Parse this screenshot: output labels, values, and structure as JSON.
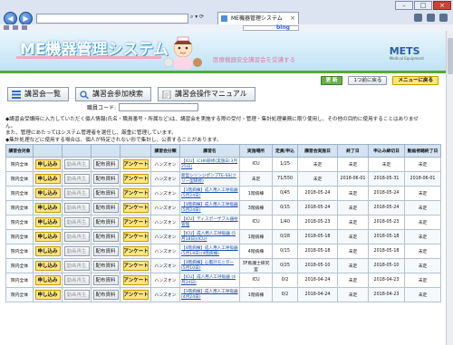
{
  "browser": {
    "tab_title": "ME機器管理システム",
    "search_engine": "bing"
  },
  "header": {
    "logo": "ME機器管理システム",
    "subtitle": "医療機器安全講習会を受講する",
    "brand": "METS",
    "brand_small": "Medical Equipment"
  },
  "top_buttons": {
    "refresh": "更 新",
    "back_one": "1つ前に戻る",
    "back_menu": "メニューに戻る"
  },
  "menu": {
    "list": "講習会一覧",
    "search": "講習会参加検索",
    "manual": "講習会操作マニュアル"
  },
  "staff": {
    "label": "職員コード:",
    "value": ""
  },
  "notes": [
    "◆講習会受講時に入力していただく個人情報(氏名・職員番号・所属など)は、講習会を実施する際の受付・管理・集計処理業務に限り使用し、その他の目的に使用することはありませ",
    "ん。",
    "また、管理にあたってはシステム管理者を選任し、厳重に管理しています。",
    "◆集計処理などに使用する場合は、個人が特定されない形で集計し、公表することがあります。"
  ],
  "table": {
    "headers": [
      "講習会対象",
      "",
      "",
      "",
      "",
      "講習会分類",
      "講習名",
      "実施場所",
      "定員/申込",
      "講習会実施日",
      "終了日",
      "申込み締切日",
      "動画視聴終了日"
    ],
    "button_labels": {
      "apply": "申し込み",
      "video": "動画再生",
      "material": "配布資料",
      "survey": "アンケート"
    },
    "rows": [
      {
        "target": "院内全体",
        "category": "ハンズオン",
        "name": "【ICU】iCHR研修(実施日:3月25日)",
        "place": "ICU",
        "capacity": "1/25",
        "date": "未定",
        "end": "未定",
        "deadline": "未定",
        "video_end": "未定"
      },
      {
        "target": "院内全体",
        "category": "ハンズオン",
        "name": "新型シリンジポンプTE-SS(ツリー型研修)",
        "place": "未定",
        "capacity": "71/550",
        "date": "未定",
        "end": "2018-06-01",
        "deadline": "2018-05-31",
        "video_end": "2018-06-01"
      },
      {
        "target": "院内全体",
        "category": "ハンズオン",
        "name": "【1階病棟】成人用人工呼吸器 (5月24日)",
        "place": "1階病棟",
        "capacity": "0/45",
        "date": "2018-05-24",
        "end": "未定",
        "deadline": "2018-05-24",
        "video_end": "未定"
      },
      {
        "target": "院内全体",
        "category": "ハンズオン",
        "name": "【3階病棟】成人用人工呼吸器 (5月24日)",
        "place": "3階病棟",
        "capacity": "0/15",
        "date": "2018-05-24",
        "end": "未定",
        "deadline": "2018-05-24",
        "video_end": "未定"
      },
      {
        "target": "院内全体",
        "category": "ハンズオン",
        "name": "【ICU】ディスポーザブル器材管理",
        "place": "ICU",
        "capacity": "1/40",
        "date": "2018-05-23",
        "end": "未定",
        "deadline": "2018-05-23",
        "video_end": "未定"
      },
      {
        "target": "院内全体",
        "category": "ハンズオン",
        "name": "【ICU】成人用人工呼吸器 (5月18日)(ICU)",
        "place": "1階病棟",
        "capacity": "0/28",
        "date": "2018-05-18",
        "end": "未定",
        "deadline": "2018-05-18",
        "video_end": "未定"
      },
      {
        "target": "院内全体",
        "category": "ハンズオン",
        "name": "【4階病棟】成人用人工呼吸器 (5月18日)(4階病棟)",
        "place": "4階病棟",
        "capacity": "0/15",
        "date": "2018-05-18",
        "end": "未定",
        "deadline": "2018-05-18",
        "video_end": "未定"
      },
      {
        "target": "院内全体",
        "category": "ハンズオン",
        "name": "【3階病棟】心電計モニター (5月10日)",
        "place": "3F看護士研究室",
        "capacity": "0/25",
        "date": "2018-05-10",
        "end": "未定",
        "deadline": "2018-05-10",
        "video_end": "未定"
      },
      {
        "target": "院内全体",
        "category": "ハンズオン",
        "name": "【ICU】成人用人工呼吸器 (4月24日)",
        "place": "ICU",
        "capacity": "0/2",
        "date": "2018-04-24",
        "end": "未定",
        "deadline": "2018-04-23",
        "video_end": "未定"
      },
      {
        "target": "院内全体",
        "category": "ハンズオン",
        "name": "【1階病棟】成人用人工呼吸器 (4月24日)",
        "place": "1階病棟",
        "capacity": "0/2",
        "date": "2018-04-24",
        "end": "未定",
        "deadline": "2018-04-23",
        "video_end": "未定"
      }
    ]
  },
  "colors": {
    "header_bg": "#bfe3f4",
    "accent_green": "#5aa832",
    "button_yellow": "#ffe680",
    "table_header": "#d3e3f2",
    "link": "#1a4ea8"
  }
}
